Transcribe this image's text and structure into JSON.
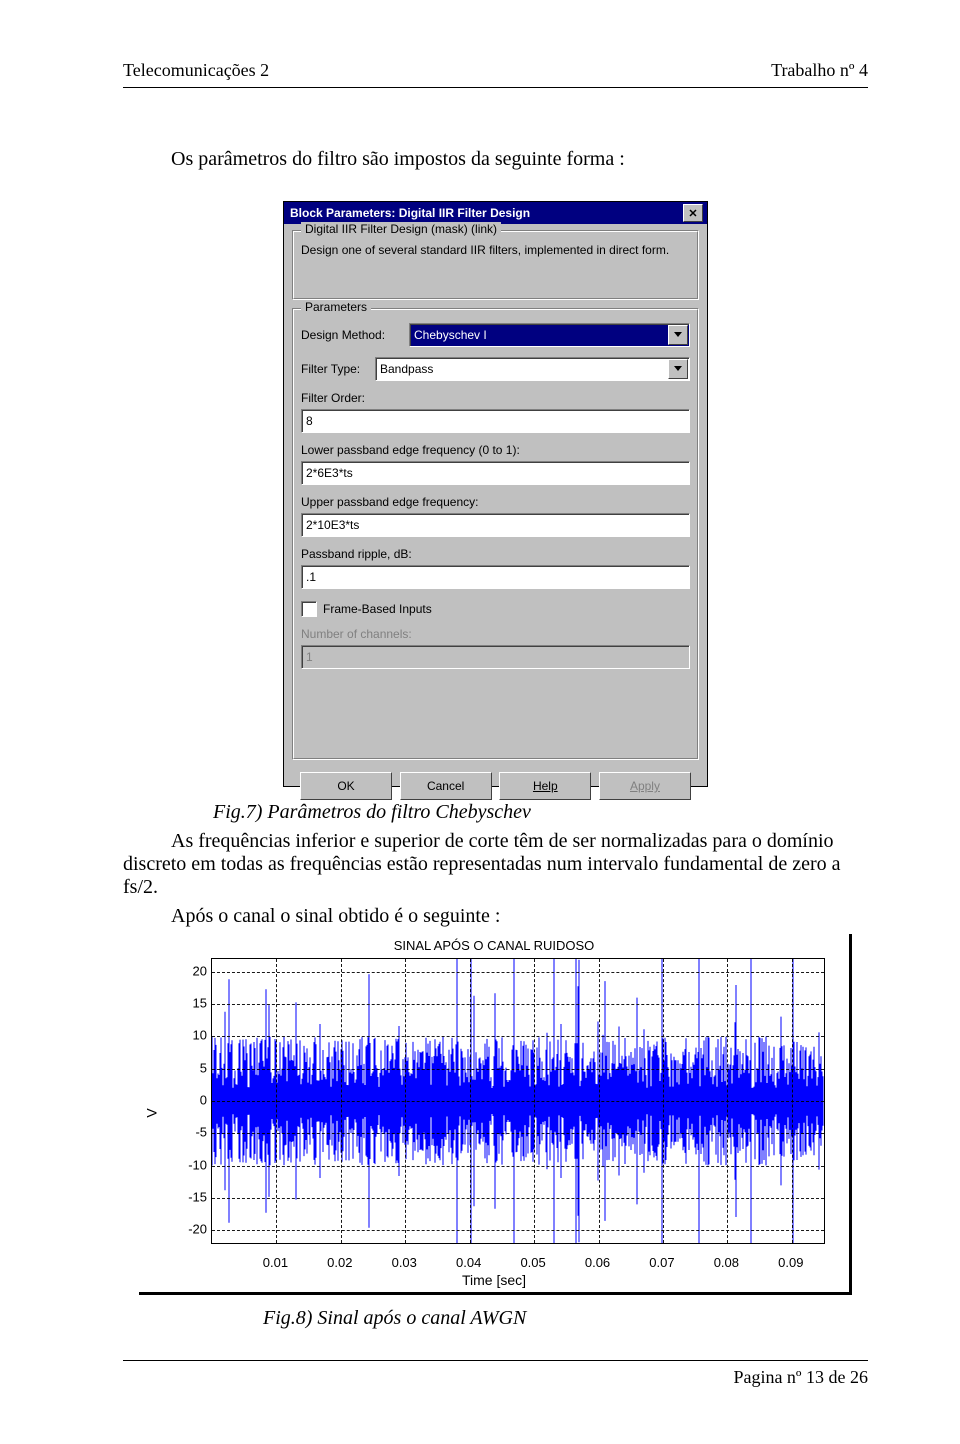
{
  "header": {
    "left": "Telecomunicações 2",
    "right": "Trabalho nº 4"
  },
  "intro": "Os parâmetros do filtro são impostos da seguinte forma :",
  "dialog": {
    "title": "Block Parameters: Digital IIR Filter Design",
    "group1_label": "Digital IIR Filter Design (mask) (link)",
    "description": "Design one of several standard IIR filters, implemented in direct form.",
    "params_label": "Parameters",
    "design_method_label": "Design Method:",
    "design_method_value": "Chebyschev I",
    "filter_type_label": "Filter Type:",
    "filter_type_value": "Bandpass",
    "filter_order_label": "Filter Order:",
    "filter_order_value": "8",
    "lower_label": "Lower passband edge frequency (0 to 1):",
    "lower_value": "2*6E3*ts",
    "upper_label": "Upper passband edge frequency:",
    "upper_value": "2*10E3*ts",
    "ripple_label": "Passband ripple, dB:",
    "ripple_value": ".1",
    "frame_label": "Frame-Based Inputs",
    "frame_checked": false,
    "channels_label": "Number of channels:",
    "channels_value": "1",
    "buttons": {
      "ok": "OK",
      "cancel": "Cancel",
      "help": "Help",
      "apply": "Apply"
    }
  },
  "caption1": "Fig.7) Parâmetros do filtro Chebyschev",
  "para1": "As frequências inferior e superior de corte têm de ser normalizadas para o domínio discreto em todas as frequências estão representadas num intervalo fundamental de zero a fs/2.",
  "para2": "Após o canal o sinal obtido é o seguinte :",
  "chart_data": {
    "type": "line",
    "title": "SINAL APÓS O CANAL RUIDOSO",
    "xlabel": "Time [sec]",
    "ylabel": "V",
    "x_ticks": [
      0.01,
      0.02,
      0.03,
      0.04,
      0.05,
      0.06,
      0.07,
      0.08,
      0.09
    ],
    "y_ticks": [
      -20,
      -15,
      -10,
      -5,
      0,
      5,
      10,
      15,
      20
    ],
    "xlim": [
      0.0,
      0.095
    ],
    "ylim": [
      -22,
      22
    ],
    "series": [
      {
        "name": "signal",
        "description": "noisy channel output, dense blue waveform roughly bounded ±14 with spikes to ±22"
      }
    ]
  },
  "caption2": "Fig.8) Sinal após o canal AWGN",
  "footer": "Pagina nº 13 de 26"
}
